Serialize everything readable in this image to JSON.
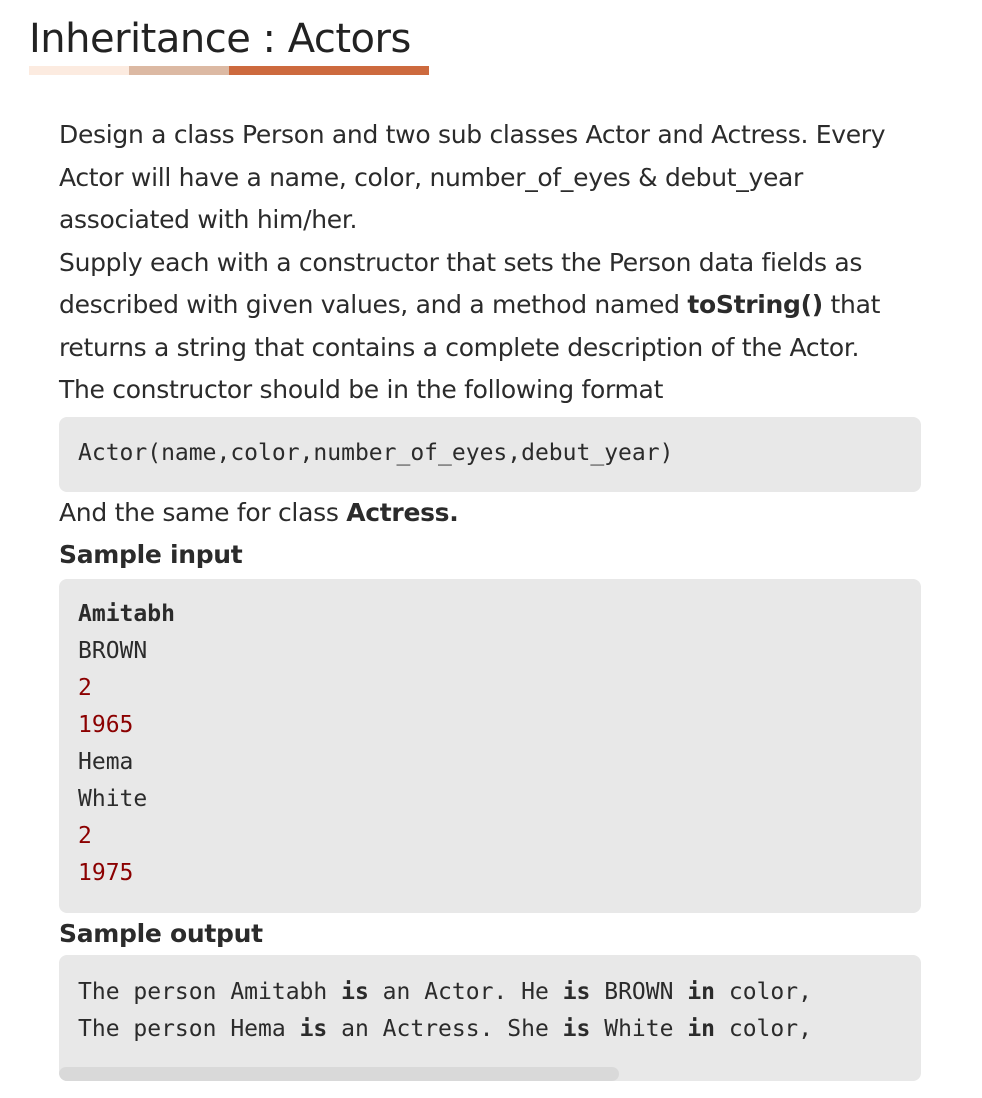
{
  "page": {
    "title": "Inheritance : Actors",
    "underline_colors": [
      "#fcebe0",
      "#dcb9a3",
      "#cd6a3e"
    ]
  },
  "description": {
    "para1": "Design a class Person and two sub classes Actor and Actress. Every Actor will have a name, color, number_of_eyes & debut_year associated with him/her.",
    "para2_before": "Supply each with a constructor that sets the Person data fields as described with given values, and a method named ",
    "para2_bold": "toString()",
    "para2_after": " that returns a string that contains a complete description of the Actor.",
    "para3": "The constructor should be in the following format"
  },
  "constructor_code": "Actor(name,color,number_of_eyes,debut_year)",
  "same_for": {
    "before": "And the same for class ",
    "bold": "Actress."
  },
  "sample_input": {
    "heading": "Sample input",
    "lines": [
      "Amitabh",
      "BROWN",
      "2",
      "1965",
      "Hema",
      "White",
      "2",
      "1975"
    ]
  },
  "sample_output": {
    "heading": "Sample output",
    "line1": {
      "p1": "The person Amitabh ",
      "k1": "is",
      "p2": " an Actor. He ",
      "k2": "is",
      "p3": " BROWN ",
      "k3": "in",
      "p4": " color,"
    },
    "line2": {
      "p1": "The person Hema ",
      "k1": "is",
      "p2": " an Actress. She ",
      "k2": "is",
      "p3": " White ",
      "k3": "in",
      "p4": " color,"
    },
    "scroll_fraction": 0.65
  },
  "colors": {
    "code_bg": "#e8e8e8",
    "number_color": "#8b0000"
  }
}
